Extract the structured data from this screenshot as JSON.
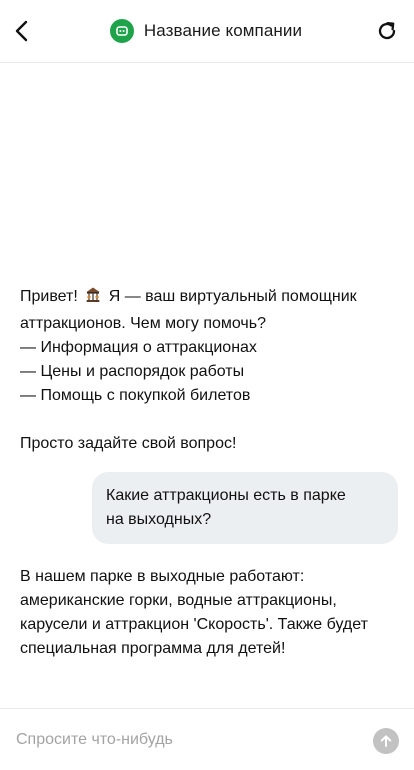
{
  "header": {
    "title": "Название компании",
    "back_icon": "chevron-left-icon",
    "refresh_icon": "refresh-icon",
    "logo_icon": "chat-bot-logo-icon",
    "logo_color": "#1fa34a"
  },
  "messages": [
    {
      "role": "bot",
      "greeting": "Привет!",
      "emoji": "carousel-emoji-icon",
      "lines": [
        "Я — ваш виртуальный помощник",
        "аттракционов. Чем могу помочь?",
        "— Информация о аттракционах",
        "— Цены и распорядок работы",
        "— Помощь с покупкой билетов",
        "",
        "Просто задайте свой вопрос!"
      ]
    },
    {
      "role": "user",
      "lines": [
        "Какие аттракционы есть в парке",
        "на выходных?"
      ],
      "bubble_color": "#eceff2"
    },
    {
      "role": "bot",
      "lines": [
        "В нашем парке в выходные работают:",
        "американские горки, водные аттракционы,",
        "карусели и аттракцион 'Скорость'. Также будет",
        "специальная программа для детей!"
      ]
    }
  ],
  "composer": {
    "placeholder": "Спросите что-нибудь",
    "value": "",
    "send_icon": "arrow-up-icon",
    "send_color": "#c2c2c2"
  }
}
